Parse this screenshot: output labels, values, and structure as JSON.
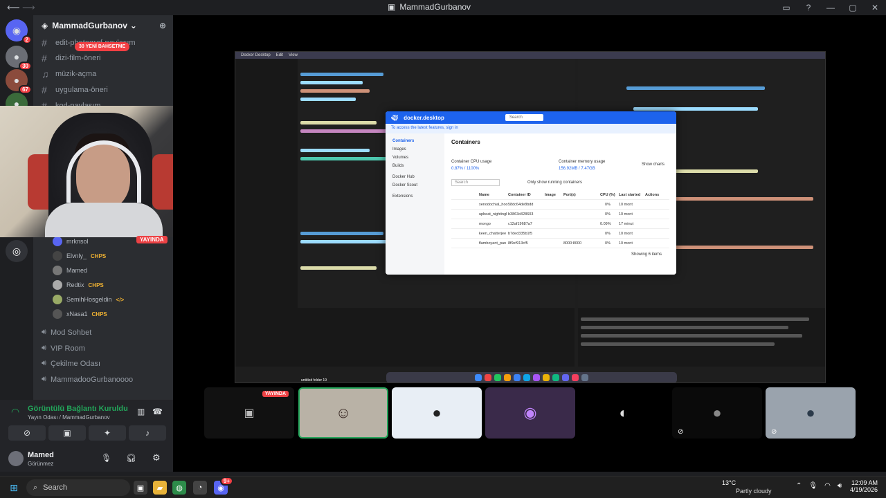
{
  "window": {
    "title": "MammadGurbanov"
  },
  "server": {
    "name": "MammadGurbanov",
    "new_messages": "30 YENİ BAHSETME"
  },
  "rail_badges": [
    "2",
    "30",
    "67",
    "20"
  ],
  "text_channels": [
    {
      "label": "edit-photograf-paylaşım",
      "icon": "hash-icon"
    },
    {
      "label": "dizi-film-öneri",
      "icon": "hash-icon"
    },
    {
      "label": "müzik-açma",
      "icon": "headphones-icon"
    },
    {
      "label": "uygulama-öneri",
      "icon": "hash-icon"
    },
    {
      "label": "kod-paylaşım",
      "icon": "hash-icon"
    }
  ],
  "voice_members": [
    {
      "name": "mrknsol",
      "live": "YAYINDA"
    },
    {
      "name": "Elvnly_",
      "badge": "CHPS"
    },
    {
      "name": "Mamed",
      "badge": ""
    },
    {
      "name": "Redtix",
      "badge": "CHPS"
    },
    {
      "name": "SemihHosgeldin",
      "badge": "</>"
    },
    {
      "name": "xNasa1",
      "badge": "CHPS"
    }
  ],
  "voice_channels": [
    {
      "label": "Mod Sohbet"
    },
    {
      "label": "VIP Room"
    },
    {
      "label": "Çekilme Odası"
    },
    {
      "label": "MammadooGurbanoooo"
    }
  ],
  "voice_panel": {
    "status": "Görüntülü Bağlantı Kuruldu",
    "sub": "Yayın Odası / MammadGurbanov"
  },
  "user": {
    "name": "Mamed",
    "status": "Görünmez"
  },
  "shared_screen": {
    "menu": [
      "Docker Desktop",
      "Edit",
      "View"
    ],
    "docker": {
      "brand": "docker.desktop",
      "search": "Search",
      "banner": "To access the latest features, sign in",
      "sidebar": [
        "Containers",
        "Images",
        "Volumes",
        "Builds",
        "Docker Hub",
        "Docker Scout",
        "Extensions"
      ],
      "heading": "Containers",
      "cpu_label": "Container CPU usage",
      "cpu_value": "0.87% / 1100%",
      "mem_label": "Container memory usage",
      "mem_value": "156.92MB / 7.47GB",
      "show_charts": "Show charts",
      "only_running": "Only show running containers",
      "columns": [
        "Name",
        "Container ID",
        "Image",
        "Port(s)",
        "CPU (%)",
        "Last started",
        "Actions"
      ],
      "rows": [
        {
          "name": "xenodochial_hoo",
          "id": "58dc64de8bdd",
          "cpu": "0%",
          "last": "10 mont"
        },
        {
          "name": "upbeat_nightingl",
          "id": "b3863c828603",
          "cpu": "0%",
          "last": "10 mont"
        },
        {
          "name": "mongo",
          "id": "c12af19687a7",
          "cpu": "0.09%",
          "last": "17 minut"
        },
        {
          "name": "keen_chatterjee",
          "id": "b7ded335b1f5",
          "cpu": "0%",
          "last": "10 mont"
        },
        {
          "name": "flamboyant_pan",
          "id": "8f9ef913cf5",
          "port": "8000:8000",
          "cpu": "0%",
          "last": "10 mont"
        }
      ],
      "footer": "Showing 6 items"
    },
    "folder_label": "untitled folder 19"
  },
  "tiles": [
    {
      "live": "YAYINDA"
    },
    {},
    {},
    {},
    {},
    {},
    {}
  ],
  "taskbar": {
    "search": "Search",
    "discord_badge": "9+",
    "temperature": "13°C",
    "weather": "Partly cloudy",
    "time": "12:09 AM",
    "date": "4/19/2026"
  },
  "colors": {
    "discord_bg": "#1e1f22",
    "accent_red": "#ed4245",
    "green": "#23a55a"
  }
}
